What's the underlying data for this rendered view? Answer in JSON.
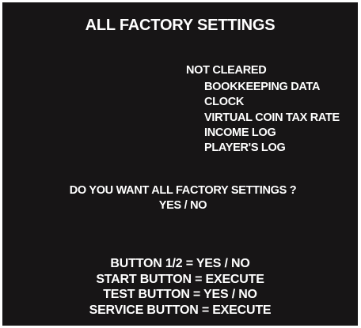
{
  "screen": {
    "title": "ALL FACTORY SETTINGS",
    "not_cleared": {
      "header": "NOT CLEARED",
      "items": [
        "BOOKKEEPING DATA",
        "CLOCK",
        "VIRTUAL COIN TAX RATE",
        "INCOME LOG",
        "PLAYER'S LOG"
      ]
    },
    "prompt": {
      "question": "DO YOU WANT ALL FACTORY SETTINGS ?",
      "options": "YES / NO"
    },
    "controls": [
      "BUTTON 1/2 = YES / NO",
      "START BUTTON = EXECUTE",
      "TEST BUTTON = YES / NO",
      "SERVICE BUTTON = EXECUTE"
    ],
    "colors": {
      "background": "#171516",
      "text": "#ffffff"
    }
  }
}
